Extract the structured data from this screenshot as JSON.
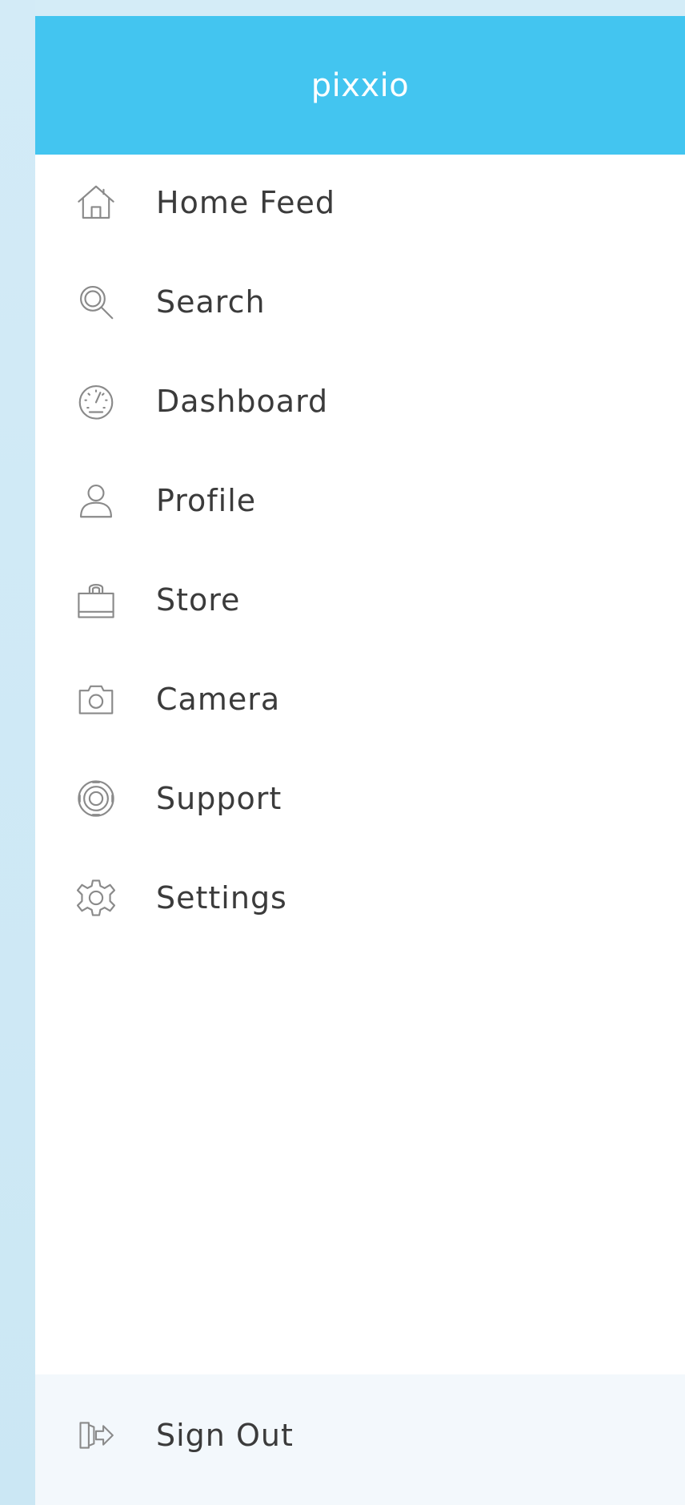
{
  "header": {
    "brand": "pixxio"
  },
  "menu": {
    "items": [
      {
        "label": "Home Feed",
        "icon": "home-icon"
      },
      {
        "label": "Search",
        "icon": "search-icon"
      },
      {
        "label": "Dashboard",
        "icon": "dashboard-gauge-icon"
      },
      {
        "label": "Profile",
        "icon": "user-icon"
      },
      {
        "label": "Store",
        "icon": "shopping-bag-icon"
      },
      {
        "label": "Camera",
        "icon": "camera-icon"
      },
      {
        "label": "Support",
        "icon": "lifebuoy-icon"
      },
      {
        "label": "Settings",
        "icon": "gear-icon"
      }
    ]
  },
  "footer": {
    "signout_label": "Sign Out",
    "signout_icon": "sign-out-icon"
  },
  "colors": {
    "header_bg": "#43c5f0",
    "backdrop": "#cfeaf6",
    "text": "#3b3b3b",
    "icon": "#8a8a8a",
    "footer_bg": "#f3f8fc"
  }
}
